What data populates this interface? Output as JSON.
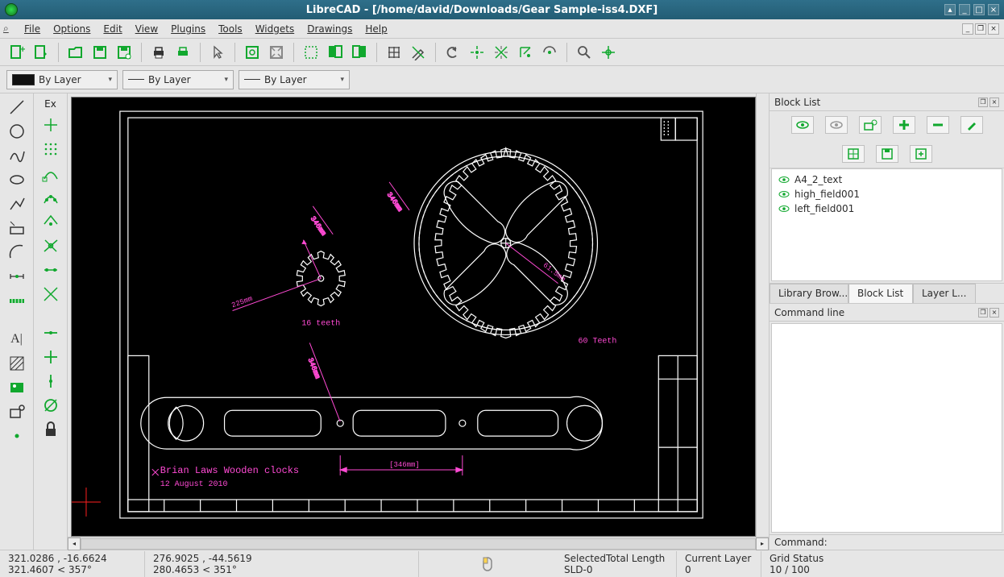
{
  "title": "LibreCAD - [/home/david/Downloads/Gear Sample-iss4.DXF]",
  "menu": {
    "hint": "⌕",
    "file": "File",
    "options": "Options",
    "edit": "Edit",
    "view": "View",
    "plugins": "Plugins",
    "tools": "Tools",
    "widgets": "Widgets",
    "drawings": "Drawings",
    "help": "Help"
  },
  "dropdowns": {
    "color": "By Layer",
    "width": "By Layer",
    "ltype": "By Layer"
  },
  "canvas": {
    "label16": "16 teeth",
    "label60": "60 Teeth",
    "author": "Brian Laws Wooden clocks",
    "date": "12 August 2010",
    "dim1": "346mm",
    "dim2": "346mm",
    "dim3": "225mm",
    "dim4": "61.5mm"
  },
  "blocklist": {
    "title": "Block List",
    "items": [
      "A4_2_text",
      "high_field001",
      "left_field001"
    ]
  },
  "tabs": {
    "library": "Library Brow...",
    "block": "Block List",
    "layer": "Layer L..."
  },
  "cmd": {
    "title": "Command line",
    "label": "Command:"
  },
  "status": {
    "abs_xy": "321.0286 , -16.6624",
    "abs_polar": "321.4607 < 357°",
    "rel_xy": "276.9025 , -44.5619",
    "rel_polar": "280.4653 < 351°",
    "selected_label": "SelectedTotal Length",
    "selected_value": "SLD-0",
    "layer_label": "Current Layer",
    "layer_value": "0",
    "grid_label": "Grid Status",
    "grid_value": "10 / 100"
  },
  "ex": "Ex"
}
